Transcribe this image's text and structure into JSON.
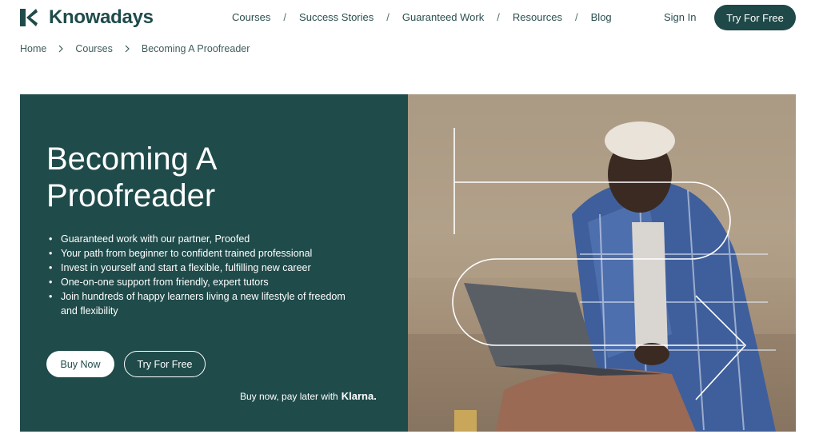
{
  "brand": {
    "name": "Knowadays"
  },
  "nav": {
    "items": [
      {
        "label": "Courses"
      },
      {
        "label": "Success Stories"
      },
      {
        "label": "Guaranteed Work"
      },
      {
        "label": "Resources"
      },
      {
        "label": "Blog"
      }
    ],
    "separator": "/",
    "sign_in": "Sign In",
    "try_free": "Try For Free"
  },
  "breadcrumb": {
    "items": [
      "Home",
      "Courses",
      "Becoming A Proofreader"
    ]
  },
  "hero": {
    "title": "Becoming A Proofreader",
    "bullets": [
      "Guaranteed work with our partner, Proofed",
      "Your path from beginner to confident trained professional",
      "Invest in yourself and start a flexible, fulfilling new career",
      "One-on-one support from friendly, expert tutors",
      "Join hundreds of happy learners living a new lifestyle of freedom and flexibility"
    ],
    "buy_now": "Buy Now",
    "try_free": "Try For Free",
    "pay_later": "Buy now, pay later with",
    "klarna": "Klarna."
  },
  "colors": {
    "brand_dark": "#1f4b4a",
    "text_dark": "#2c4f4f",
    "white": "#ffffff"
  },
  "icons": {
    "logo": "knowadays-logo-icon",
    "breadcrumb_separator": "chevron-right-icon"
  }
}
